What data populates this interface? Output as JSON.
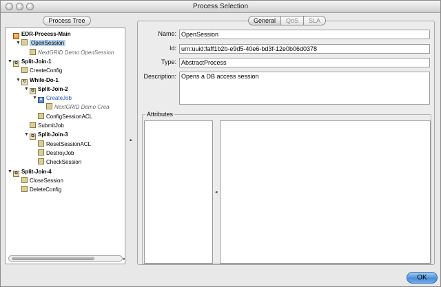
{
  "window": {
    "title": "Process Selection"
  },
  "left": {
    "header": "Process Tree",
    "tree": [
      {
        "label": "EDR-Process-Main",
        "icon": "main-process",
        "depth": 0,
        "bold": true,
        "expander": ""
      },
      {
        "label": "OpenSession",
        "icon": "activity",
        "depth": 1,
        "selected": true,
        "expander": "▼"
      },
      {
        "label": "NextGRID Demo OpenSession",
        "icon": "service",
        "depth": 2,
        "italic": true,
        "expander": ""
      },
      {
        "label": "Split-Join-1",
        "icon": "parallel",
        "depth": 0,
        "bold": true,
        "expander": "▼"
      },
      {
        "label": "CreateConfig",
        "icon": "activity",
        "depth": 1,
        "expander": ""
      },
      {
        "label": "While-Do-1",
        "icon": "loop",
        "depth": 1,
        "bold": true,
        "expander": "▼"
      },
      {
        "label": "Split-Join-2",
        "icon": "parallel",
        "depth": 2,
        "bold": true,
        "expander": "▼"
      },
      {
        "label": "CreateJob",
        "icon": "invoke",
        "depth": 3,
        "blue": true,
        "expander": "▼"
      },
      {
        "label": "NextGRID Demo Crea",
        "icon": "service",
        "depth": 4,
        "italic": true,
        "expander": ""
      },
      {
        "label": "ConfigSessionACL",
        "icon": "activity",
        "depth": 3,
        "expander": ""
      },
      {
        "label": "SubmitJob",
        "icon": "activity",
        "depth": 2,
        "expander": ""
      },
      {
        "label": "Split-Join-3",
        "icon": "parallel",
        "depth": 2,
        "bold": true,
        "expander": "▼"
      },
      {
        "label": "ResetSessionACL",
        "icon": "activity",
        "depth": 3,
        "expander": ""
      },
      {
        "label": "DestroyJob",
        "icon": "activity",
        "depth": 3,
        "expander": ""
      },
      {
        "label": "CheckSession",
        "icon": "activity",
        "depth": 3,
        "expander": ""
      },
      {
        "label": "Split-Join-4",
        "icon": "parallel",
        "depth": 0,
        "bold": true,
        "expander": "▼"
      },
      {
        "label": "CloseSession",
        "icon": "activity",
        "depth": 1,
        "expander": ""
      },
      {
        "label": "DeleteConfig",
        "icon": "activity",
        "depth": 1,
        "expander": ""
      }
    ]
  },
  "right": {
    "tabs": [
      {
        "label": "General",
        "active": true
      },
      {
        "label": "QoS",
        "active": false
      },
      {
        "label": "SLA",
        "active": false
      }
    ],
    "fields": {
      "name_label": "Name:",
      "name_value": "OpenSession",
      "id_label": "Id:",
      "id_value": "urn:uuid:faff1b2b-e9d5-40e6-bd3f-12e0b06d0378",
      "type_label": "Type:",
      "type_value": "AbstractProcess",
      "description_label": "Description:",
      "description_value": "Opens a DB access session"
    },
    "attributes_title": "Attributes"
  },
  "footer": {
    "ok_label": "OK"
  }
}
